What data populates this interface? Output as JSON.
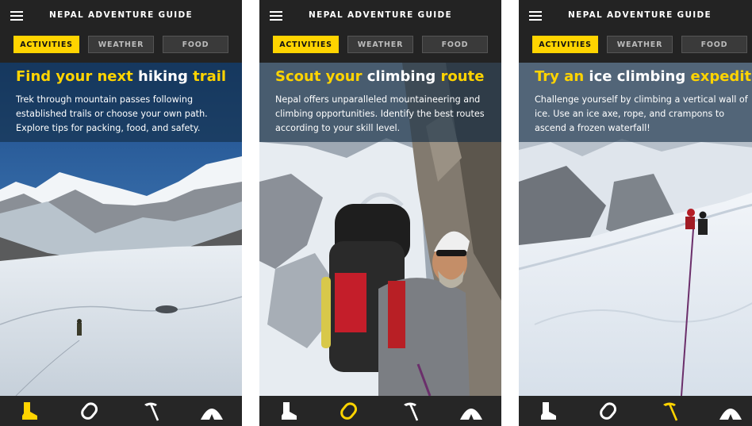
{
  "colors": {
    "accent": "#ffd400",
    "header_bg": "#232323",
    "nav_bg": "#262626",
    "overlay": "#142d46"
  },
  "screens": [
    {
      "app_title": "NEPAL ADVENTURE GUIDE",
      "tabs": [
        {
          "label": "ACTIVITIES",
          "active": true
        },
        {
          "label": "WEATHER",
          "active": false
        },
        {
          "label": "FOOD",
          "active": false
        }
      ],
      "headline": {
        "part1": "Find your next ",
        "part2": "hiking",
        "part3": " trail"
      },
      "body": "Trek through mountain passes following established trails or choose your own path. Explore tips for packing, food, and safety.",
      "scene": "snowy glacier with a lone hiker under blue sky",
      "nav": [
        {
          "icon": "hiking-boot-icon",
          "active": true
        },
        {
          "icon": "carabiner-icon",
          "active": false
        },
        {
          "icon": "ice-axe-icon",
          "active": false
        },
        {
          "icon": "tent-icon",
          "active": false
        }
      ]
    },
    {
      "app_title": "NEPAL ADVENTURE GUIDE",
      "tabs": [
        {
          "label": "ACTIVITIES",
          "active": true
        },
        {
          "label": "WEATHER",
          "active": false
        },
        {
          "label": "FOOD",
          "active": false
        }
      ],
      "headline": {
        "part1": "Scout your ",
        "part2": "climbing",
        "part3": " route"
      },
      "body": "Nepal offers unparalleled mountaineering and climbing opportunities. Identify the best routes according to your skill level.",
      "scene": "climber with red backpack and helmet on a rock face",
      "nav": [
        {
          "icon": "hiking-boot-icon",
          "active": false
        },
        {
          "icon": "carabiner-icon",
          "active": true
        },
        {
          "icon": "ice-axe-icon",
          "active": false
        },
        {
          "icon": "tent-icon",
          "active": false
        }
      ]
    },
    {
      "app_title": "NEPAL ADVENTURE GUIDE",
      "tabs": [
        {
          "label": "ACTIVITIES",
          "active": true
        },
        {
          "label": "WEATHER",
          "active": false
        },
        {
          "label": "FOOD",
          "active": false
        }
      ],
      "headline": {
        "part1": "Try an ",
        "part2": "ice climbing",
        "part3": " expedition"
      },
      "body": "Challenge yourself by climbing a vertical wall of ice. Use an ice axe, rope, and crampons to ascend a frozen waterfall!",
      "scene": "climbers roped up on a snowy ice ridge",
      "nav": [
        {
          "icon": "hiking-boot-icon",
          "active": false
        },
        {
          "icon": "carabiner-icon",
          "active": false
        },
        {
          "icon": "ice-axe-icon",
          "active": true
        },
        {
          "icon": "tent-icon",
          "active": false
        }
      ]
    }
  ]
}
